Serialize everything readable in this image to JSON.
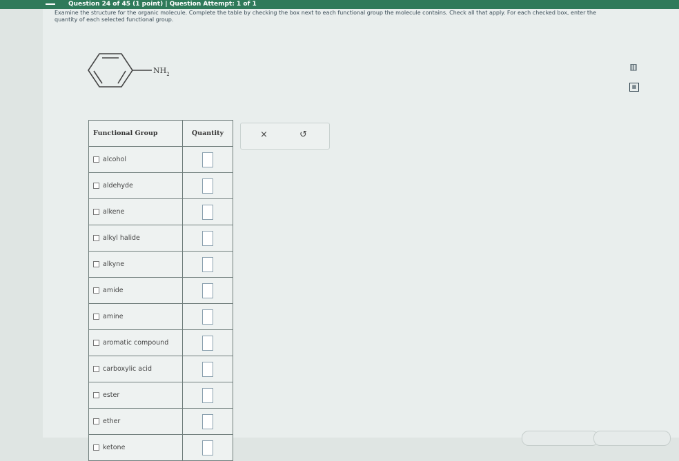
{
  "header": {
    "question_info": "Question 24 of 45 (1 point) | Question Attempt: 1 of 1"
  },
  "instructions": "Examine the structure for the organic molecule. Complete the table by checking the box next to each functional group the molecule contains. Check all that apply. For each checked box, enter the quantity of each selected functional group.",
  "molecule": {
    "substituent_label": "NH",
    "substituent_subscript": "2"
  },
  "table": {
    "headers": {
      "functional_group": "Functional Group",
      "quantity": "Quantity"
    },
    "rows": [
      {
        "label": "alcohol",
        "checked": false,
        "quantity": ""
      },
      {
        "label": "aldehyde",
        "checked": false,
        "quantity": ""
      },
      {
        "label": "alkene",
        "checked": false,
        "quantity": ""
      },
      {
        "label": "alkyl halide",
        "checked": false,
        "quantity": ""
      },
      {
        "label": "alkyne",
        "checked": false,
        "quantity": ""
      },
      {
        "label": "amide",
        "checked": false,
        "quantity": ""
      },
      {
        "label": "amine",
        "checked": false,
        "quantity": ""
      },
      {
        "label": "aromatic compound",
        "checked": false,
        "quantity": ""
      },
      {
        "label": "carboxylic acid",
        "checked": false,
        "quantity": ""
      },
      {
        "label": "ester",
        "checked": false,
        "quantity": ""
      },
      {
        "label": "ether",
        "checked": false,
        "quantity": ""
      },
      {
        "label": "ketone",
        "checked": false,
        "quantity": ""
      }
    ]
  },
  "tools": {
    "clear_symbol": "×",
    "undo_symbol": "↺"
  },
  "side": {
    "chart_icon": "bar-chart-icon",
    "calculator_icon": "calculator-icon"
  },
  "colors": {
    "header_bar": "#2f7a5a",
    "page_bg": "#e9eeed",
    "table_border": "#6f7d7b"
  }
}
